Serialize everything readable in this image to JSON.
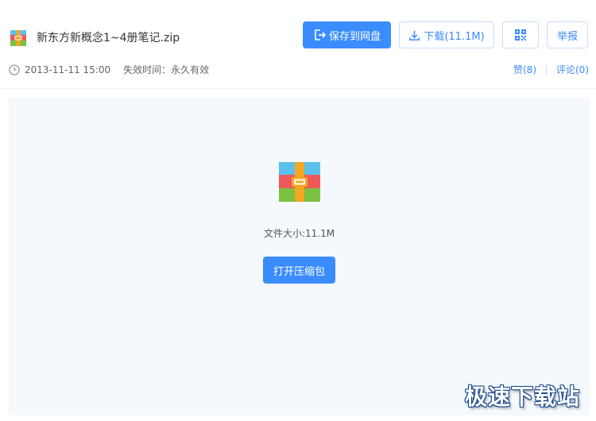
{
  "file": {
    "title": "新东方新概念1~4册笔记.zip",
    "icon": "zip-archive-icon"
  },
  "toolbar": {
    "save_label": "保存到网盘",
    "download_label": "下载(11.1M)",
    "qr_icon": "qrcode-icon",
    "report_label": "举报"
  },
  "meta": {
    "date": "2013-11-11 15:00",
    "expire": "失效时间：永久有效"
  },
  "social": {
    "like_label": "赞(8)",
    "comment_label": "评论(0)"
  },
  "preview": {
    "size_text": "文件大小:11.1M",
    "open_label": "打开压缩包"
  },
  "watermark": "极速下载站",
  "colors": {
    "accent": "#3b8cff",
    "preview_bg": "#f5f8fc",
    "zip_blue": "#5bc0eb",
    "zip_red": "#f0595a",
    "zip_green": "#7cc242",
    "zip_orange": "#f5a623"
  }
}
